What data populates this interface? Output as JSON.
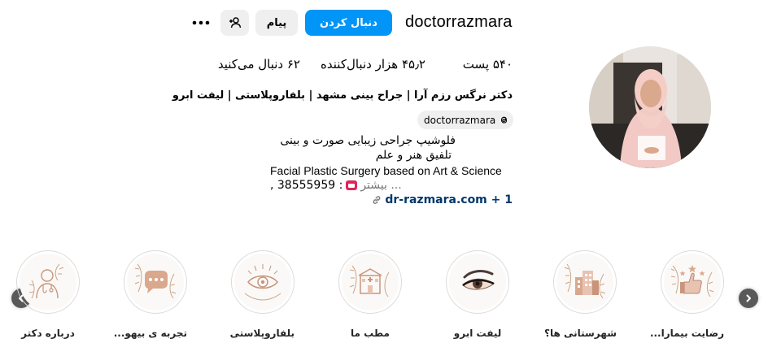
{
  "profile": {
    "username": "doctorrazmara",
    "follow_label": "دنبال کردن",
    "message_label": "پیام",
    "posts": "۵۴۰ پست",
    "followers": "۴۵٫۲ هزار دنبال‌کننده",
    "following": "۶۲ دنبال می‌کنید",
    "full_name": "دکتر نرگس رزم آرا | جراح بینی مشهد | بلفاروپلاستی | لیفت ابرو",
    "threads_handle": "doctorrazmara",
    "bio_line1": "فلوشیپ جراحی زیبایی صورت و بینی",
    "bio_line2": "تلفیق هنر و علم",
    "bio_line3": "Facial Plastic Surgery based on Art & Science",
    "bio_phone": ", 38555959 :",
    "bio_more": "بیشتر ...",
    "link_text": "dr-razmara.com + 1"
  },
  "highlights": [
    {
      "label": "رضایت بیمارا...",
      "icon": "thumbs-up-stars-icon"
    },
    {
      "label": "شهرستانی ها؟",
      "icon": "buildings-icon"
    },
    {
      "label": "لیفت ابرو",
      "icon": "eye-makeup-icon"
    },
    {
      "label": "مطب ما",
      "icon": "clinic-icon"
    },
    {
      "label": "بلفاروپلاستی",
      "icon": "eye-icon"
    },
    {
      "label": "تجربه ی بیهو...",
      "icon": "chat-bubble-icon"
    },
    {
      "label": "درباره دکتر",
      "icon": "doctor-icon"
    }
  ],
  "colors": {
    "accent": "#0095f6",
    "link": "#00376b",
    "highlight_rose": "#c9957a"
  }
}
